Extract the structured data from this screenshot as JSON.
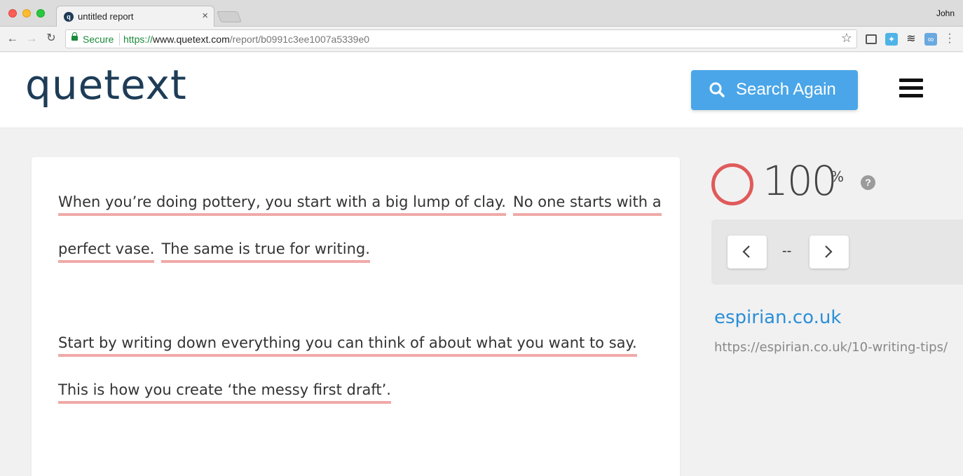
{
  "browser": {
    "tab_title": "untitled report",
    "tab_close": "×",
    "profile_name": "John",
    "secure_label": "Secure",
    "url_scheme": "https://",
    "url_host": "www.quetext.com",
    "url_path": "/report/b0991c3ee1007a5339e0"
  },
  "header": {
    "logo": "quetext",
    "search_button": "Search Again"
  },
  "document": {
    "lines": [
      [
        "When you’re doing pottery, you start with a big lump of clay.",
        "No one starts with a"
      ],
      [
        "perfect vase.",
        "The same is true for writing."
      ],
      [
        "Start by writing down everything you can think of about what you want to say."
      ],
      [
        "This is how you create ‘the messy first draft’."
      ]
    ],
    "highlight_color": "#efaaa8"
  },
  "results": {
    "score_value": "100",
    "score_unit": "%",
    "help": "?",
    "pager_count": "--",
    "source_title": "espirian.co.uk",
    "source_url": "https://espirian.co.uk/10-writing-tips/",
    "score_color": "#e05a5a",
    "accent_color": "#4aa6e8"
  }
}
